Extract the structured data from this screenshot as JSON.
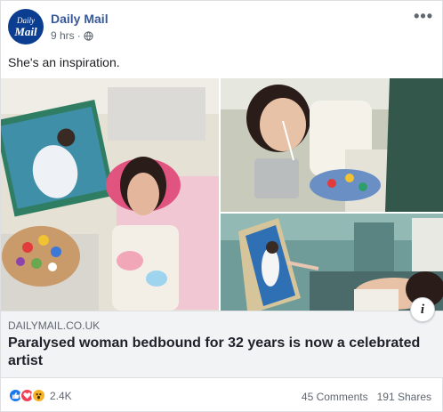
{
  "post": {
    "page_name": "Daily Mail",
    "avatar_line1": "Daily",
    "avatar_line2": "Mail",
    "time": "9 hrs",
    "separator": "·",
    "privacy_icon": "globe-icon",
    "more_label": "•••",
    "text": "She's an inspiration."
  },
  "link_preview": {
    "domain": "DAILYMAIL.CO.UK",
    "headline": "Paralysed woman bedbound for 32 years is now a celebrated artist",
    "info_label": "i"
  },
  "engagement": {
    "reaction_icons": [
      "like-icon",
      "love-icon",
      "wow-icon"
    ],
    "reaction_count": "2.4K",
    "comments": "45 Comments",
    "shares": "191 Shares"
  },
  "colors": {
    "link_blue": "#385898",
    "brand_navy": "#0b3d91",
    "like_blue": "#1877f2",
    "love_red": "#f33e58",
    "wow_yellow": "#f7b125",
    "preview_bg": "#f2f3f5",
    "meta_gray": "#606770"
  }
}
